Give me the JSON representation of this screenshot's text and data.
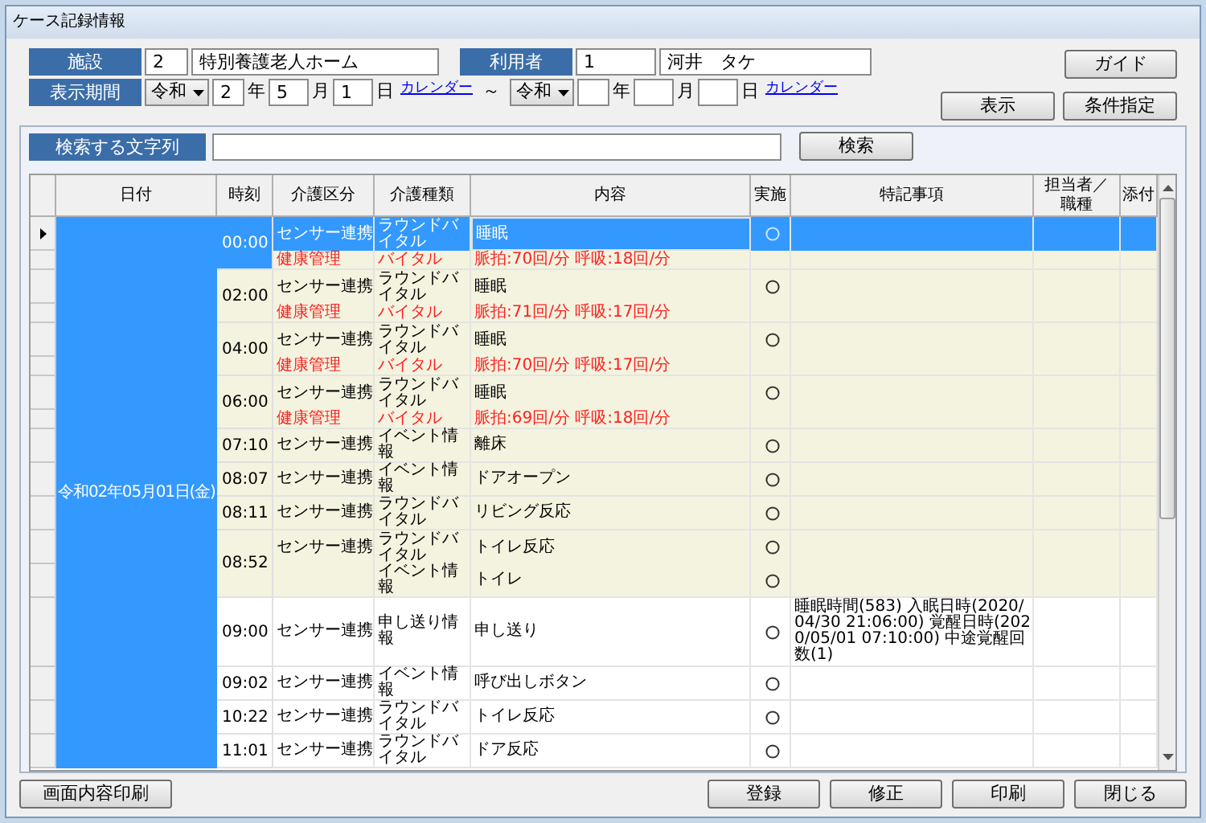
{
  "window": {
    "title": "ケース記録情報"
  },
  "facility": {
    "label": "施設",
    "code": "2",
    "name": "特別養護老人ホーム"
  },
  "user": {
    "label": "利用者",
    "code": "1",
    "name": "河井　タケ"
  },
  "guide_button": "ガイド",
  "period": {
    "label": "表示期間",
    "separator": "～",
    "from": {
      "era": "令和",
      "year": "2",
      "year_unit": "年",
      "month": "5",
      "month_unit": "月",
      "day": "1",
      "day_unit": "日",
      "calendar_link": "カレンダー"
    },
    "to": {
      "era": "令和",
      "year_unit": "年",
      "month_unit": "月",
      "day_unit": "日",
      "calendar_link": "カレンダー"
    }
  },
  "view_buttons": [
    "表示",
    "条件指定"
  ],
  "search": {
    "label": "検索する文字列",
    "button": "検索"
  },
  "table": {
    "columns": [
      "日付",
      "時刻",
      "介護区分",
      "介護種類",
      "内容",
      "実施",
      "特記事項",
      "担当者／職種",
      "添付"
    ],
    "date": "令和02年05月01日(金)",
    "records": [
      {
        "time": "00:00",
        "selected": true,
        "shaded": true,
        "entries": [
          {
            "kind": "sensor",
            "category": "センサー連携",
            "type": "ラウンドバイタル",
            "content": "睡眠",
            "done": true
          },
          {
            "kind": "vital",
            "category": "健康管理",
            "type": "バイタル",
            "content": "脈拍:70回/分 呼吸:18回/分",
            "done": false
          }
        ]
      },
      {
        "time": "02:00",
        "selected": false,
        "shaded": true,
        "entries": [
          {
            "kind": "sensor",
            "category": "センサー連携",
            "type": "ラウンドバイタル",
            "content": "睡眠",
            "done": true
          },
          {
            "kind": "vital",
            "category": "健康管理",
            "type": "バイタル",
            "content": "脈拍:71回/分 呼吸:17回/分",
            "done": false
          }
        ]
      },
      {
        "time": "04:00",
        "selected": false,
        "shaded": true,
        "entries": [
          {
            "kind": "sensor",
            "category": "センサー連携",
            "type": "ラウンドバイタル",
            "content": "睡眠",
            "done": true
          },
          {
            "kind": "vital",
            "category": "健康管理",
            "type": "バイタル",
            "content": "脈拍:70回/分 呼吸:17回/分",
            "done": false
          }
        ]
      },
      {
        "time": "06:00",
        "selected": false,
        "shaded": true,
        "entries": [
          {
            "kind": "sensor",
            "category": "センサー連携",
            "type": "ラウンドバイタル",
            "content": "睡眠",
            "done": true
          },
          {
            "kind": "vital",
            "category": "健康管理",
            "type": "バイタル",
            "content": "脈拍:69回/分 呼吸:18回/分",
            "done": false
          }
        ]
      },
      {
        "time": "07:10",
        "selected": false,
        "shaded": true,
        "entries": [
          {
            "kind": "sensor",
            "category": "センサー連携",
            "type": "イベント情報",
            "content": "離床",
            "done": true
          }
        ]
      },
      {
        "time": "08:07",
        "selected": false,
        "shaded": true,
        "entries": [
          {
            "kind": "sensor",
            "category": "センサー連携",
            "type": "イベント情報",
            "content": "ドアオープン",
            "done": true
          }
        ]
      },
      {
        "time": "08:11",
        "selected": false,
        "shaded": true,
        "entries": [
          {
            "kind": "sensor",
            "category": "センサー連携",
            "type": "ラウンドバイタル",
            "content": "リビング反応",
            "done": true
          }
        ]
      },
      {
        "time": "08:52",
        "selected": false,
        "shaded": true,
        "entries": [
          {
            "kind": "sensor",
            "category": "センサー連携",
            "type": "ラウンドバイタル",
            "content": "トイレ反応",
            "done": true
          },
          {
            "kind": "sensor",
            "type": "イベント情報",
            "content": "トイレ",
            "done": true
          }
        ]
      },
      {
        "time": "09:00",
        "selected": false,
        "shaded": false,
        "entries": [
          {
            "kind": "sensor",
            "category": "センサー連携",
            "type": "申し送り情報",
            "content": "申し送り",
            "done": true,
            "note": "睡眠時間(583) 入眠日時(2020/04/30 21:06:00) 覚醒日時(2020/05/01 07:10:00) 中途覚醒回数(1)"
          }
        ]
      },
      {
        "time": "09:02",
        "selected": false,
        "shaded": false,
        "entries": [
          {
            "kind": "sensor",
            "category": "センサー連携",
            "type": "イベント情報",
            "content": "呼び出しボタン",
            "done": true
          }
        ]
      },
      {
        "time": "10:22",
        "selected": false,
        "shaded": false,
        "entries": [
          {
            "kind": "sensor",
            "category": "センサー連携",
            "type": "ラウンドバイタル",
            "content": "トイレ反応",
            "done": true
          }
        ]
      },
      {
        "time": "11:01",
        "selected": false,
        "shaded": false,
        "entries": [
          {
            "kind": "sensor",
            "category": "センサー連携",
            "type": "ラウンドバイタル",
            "content": "ドア反応",
            "done": true
          }
        ]
      }
    ]
  },
  "footer": {
    "print_screen_button": "画面内容印刷",
    "buttons": [
      "登録",
      "修正",
      "印刷",
      "閉じる"
    ]
  }
}
